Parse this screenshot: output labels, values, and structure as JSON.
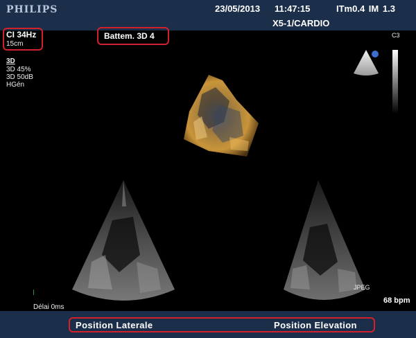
{
  "header": {
    "brand": "PHILIPS",
    "date": "23/05/2013",
    "time": "11:47:15",
    "indices": "ITm0.4  IM 1.3",
    "probe": "X5-1/CARDIO"
  },
  "left_info": {
    "ci": "CI 34Hz",
    "depth": "15cm",
    "mode": "3D",
    "gain": "3D 45%",
    "dyn": "3D 50dB",
    "harm": "HGén"
  },
  "center_label": "Battem. 3D 4",
  "scale_label": "C3",
  "delay": "Délai 0ms",
  "jpeg": "JPEG",
  "bpm": "68 bpm",
  "footer": {
    "left": "Position Laterale",
    "right": "Position Elevation"
  }
}
